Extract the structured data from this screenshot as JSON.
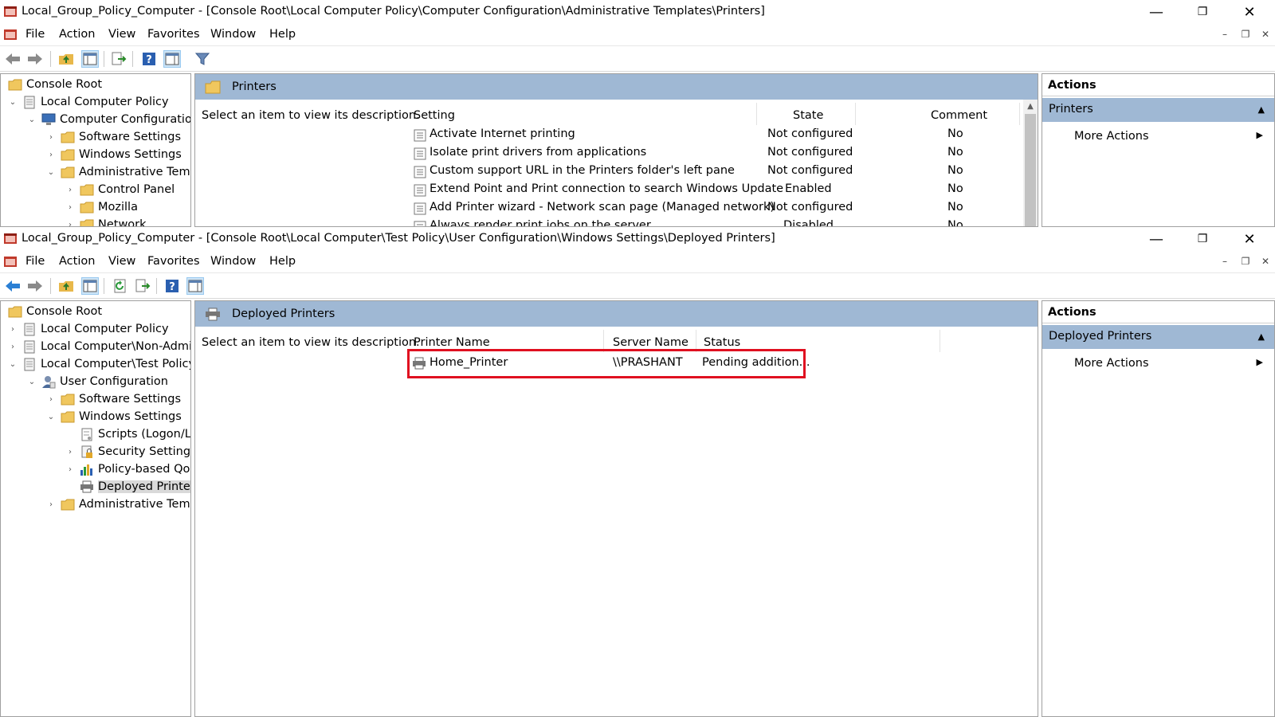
{
  "window1": {
    "title": "Local_Group_Policy_Computer - [Console Root\\Local Computer Policy\\Computer Configuration\\Administrative Templates\\Printers]",
    "menu": [
      "File",
      "Action",
      "View",
      "Favorites",
      "Window",
      "Help"
    ],
    "tree": [
      {
        "label": "Console Root"
      },
      {
        "label": "Local Computer Policy"
      },
      {
        "label": "Computer Configuration"
      },
      {
        "label": "Software Settings"
      },
      {
        "label": "Windows Settings"
      },
      {
        "label": "Administrative Templates"
      },
      {
        "label": "Control Panel"
      },
      {
        "label": "Mozilla"
      },
      {
        "label": "Network"
      }
    ],
    "center": {
      "title": "Printers",
      "description": "Select an item to view its description.",
      "columns": [
        "Setting",
        "State",
        "Comment"
      ],
      "rows": [
        {
          "setting": "Activate Internet printing",
          "state": "Not configured",
          "comment": "No"
        },
        {
          "setting": "Isolate print drivers from applications",
          "state": "Not configured",
          "comment": "No"
        },
        {
          "setting": "Custom support URL in the Printers folder's left pane",
          "state": "Not configured",
          "comment": "No"
        },
        {
          "setting": "Extend Point and Print connection to search Windows Update",
          "state": "Enabled",
          "comment": "No"
        },
        {
          "setting": "Add Printer wizard - Network scan page (Managed network)",
          "state": "Not configured",
          "comment": "No"
        },
        {
          "setting": "Always render print jobs on the server",
          "state": "Disabled",
          "comment": "No"
        }
      ]
    },
    "actions": {
      "header": "Actions",
      "section": "Printers",
      "more": "More Actions"
    }
  },
  "window2": {
    "title": "Local_Group_Policy_Computer - [Console Root\\Local Computer\\Test Policy\\User Configuration\\Windows Settings\\Deployed Printers]",
    "menu": [
      "File",
      "Action",
      "View",
      "Favorites",
      "Window",
      "Help"
    ],
    "tree": [
      {
        "label": "Console Root"
      },
      {
        "label": "Local Computer Policy"
      },
      {
        "label": "Local Computer\\Non-Administrators Policy"
      },
      {
        "label": "Local Computer\\Test Policy"
      },
      {
        "label": "User Configuration"
      },
      {
        "label": "Software Settings"
      },
      {
        "label": "Windows Settings"
      },
      {
        "label": "Scripts (Logon/Logoff)"
      },
      {
        "label": "Security Settings"
      },
      {
        "label": "Policy-based QoS"
      },
      {
        "label": "Deployed Printers"
      },
      {
        "label": "Administrative Templates"
      }
    ],
    "center": {
      "title": "Deployed Printers",
      "description": "Select an item to view its description.",
      "columns": [
        "Printer Name",
        "Server Name",
        "Status"
      ],
      "rows": [
        {
          "printer": "Home_Printer",
          "server": "\\\\PRASHANT",
          "status": "Pending addition..."
        }
      ]
    },
    "actions": {
      "header": "Actions",
      "section": "Deployed Printers",
      "more": "More Actions"
    }
  },
  "colors": {
    "accent_header": "#9fb8d4",
    "highlight": "#e01020"
  }
}
